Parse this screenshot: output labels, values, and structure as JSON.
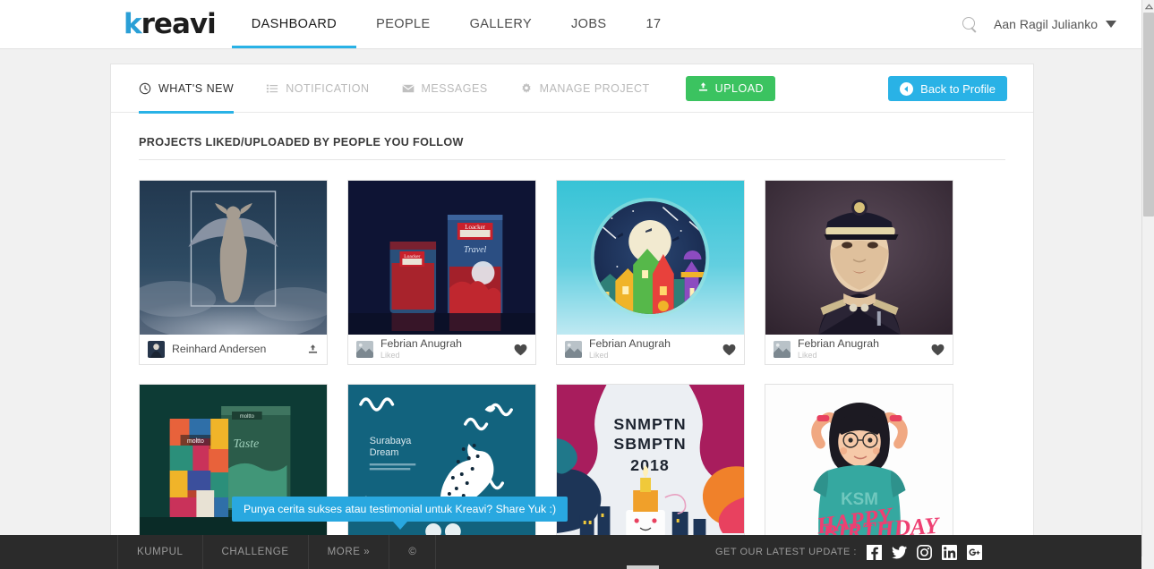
{
  "topnav": {
    "brand": "kreavi",
    "brand_first": "k",
    "brand_rest": "reavi",
    "items": [
      {
        "label": "DASHBOARD",
        "active": true
      },
      {
        "label": "PEOPLE",
        "active": false
      },
      {
        "label": "GALLERY",
        "active": false
      },
      {
        "label": "JOBS",
        "active": false
      },
      {
        "label": "17",
        "active": false
      }
    ],
    "search_icon": "search-icon",
    "user_name": "Aan Ragil Julianko",
    "caret_icon": "chevron-down-icon"
  },
  "tabs": [
    {
      "label": "WHAT'S NEW",
      "icon": "clock-icon",
      "active": true
    },
    {
      "label": "NOTIFICATION",
      "icon": "list-icon",
      "active": false
    },
    {
      "label": "MESSAGES",
      "icon": "envelope-icon",
      "active": false
    },
    {
      "label": "MANAGE PROJECT",
      "icon": "gear-icon",
      "active": false
    }
  ],
  "buttons": {
    "upload_label": "UPLOAD",
    "upload_icon": "upload-icon",
    "upload_color": "#3bc360",
    "back_label": "Back to Profile",
    "back_icon": "back-arrow-icon",
    "back_color": "#29b2e6"
  },
  "section": {
    "title": "PROJECTS LIKED/UPLOADED BY PEOPLE YOU FOLLOW"
  },
  "cards": [
    {
      "author": "Reinhard Andersen",
      "subtitle": "",
      "action_icon": "upload-icon",
      "thumb": "angel-wings-dark-blue"
    },
    {
      "author": "Febrian Anugrah",
      "subtitle": "Liked",
      "action_icon": "heart-icon",
      "thumb": "loacker-packaging-navy"
    },
    {
      "author": "Febrian Anugrah",
      "subtitle": "Liked",
      "action_icon": "heart-icon",
      "thumb": "night-town-circle-illustration"
    },
    {
      "author": "Febrian Anugrah",
      "subtitle": "Liked",
      "action_icon": "heart-icon",
      "thumb": "officer-portrait-painting"
    },
    {
      "author": "",
      "subtitle": "",
      "action_icon": "",
      "thumb": "colorful-pouch-packaging-green"
    },
    {
      "author": "",
      "subtitle": "",
      "action_icon": "",
      "thumb": "surabaya-dream-koi-teal"
    },
    {
      "author": "",
      "subtitle": "",
      "action_icon": "",
      "thumb": "snmptn-sbmptn-2018-poster"
    },
    {
      "author": "",
      "subtitle": "",
      "action_icon": "",
      "thumb": "happy-birthday-girl-illustration"
    }
  ],
  "thumb_text": {
    "card6_line1": "Surabaya",
    "card6_line2": "Dream",
    "card7_line1": "SNMPTN",
    "card7_line2": "SBMPTN",
    "card7_line3": "2018",
    "card8_shirt": "KSM",
    "card8_title": "HAPPY BIRTHDAY",
    "loacker": "Loacker"
  },
  "tooltip": {
    "text": "Punya cerita sukses atau testimonial untuk Kreavi? Share Yuk :)",
    "color": "#29a8e0"
  },
  "footer": {
    "links": [
      "KUMPUL",
      "CHALLENGE",
      "MORE »",
      "©"
    ],
    "update_label": "GET OUR LATEST UPDATE :",
    "socials": [
      "facebook-icon",
      "twitter-icon",
      "instagram-icon",
      "linkedin-icon",
      "googleplus-icon"
    ]
  },
  "scrollbar": {
    "up_arrow": "chevron-up-icon",
    "down_arrow": "chevron-down-icon"
  }
}
